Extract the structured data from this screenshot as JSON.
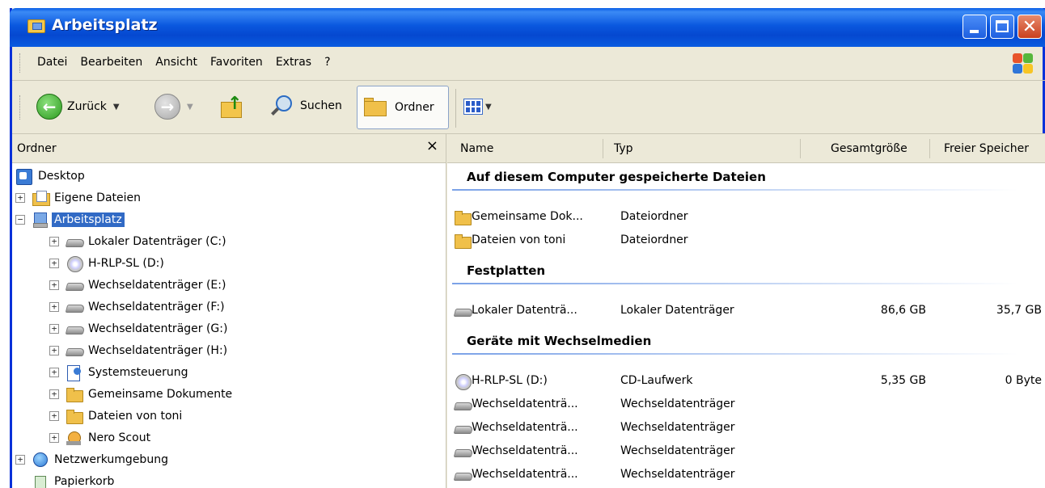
{
  "window": {
    "title": "Arbeitsplatz"
  },
  "menu": [
    "Datei",
    "Bearbeiten",
    "Ansicht",
    "Favoriten",
    "Extras",
    "?"
  ],
  "toolbar": {
    "back_label": "Zurück",
    "search_label": "Suchen",
    "folders_label": "Ordner"
  },
  "left_pane": {
    "title": "Ordner",
    "close_glyph": "×",
    "tree": [
      {
        "label": "Desktop",
        "icon": "desktop-icon",
        "level": 0,
        "toggle": ""
      },
      {
        "label": "Eigene Dateien",
        "icon": "my-documents-icon",
        "level": 1,
        "toggle": "+"
      },
      {
        "label": "Arbeitsplatz",
        "icon": "my-computer-icon",
        "level": 1,
        "toggle": "−",
        "selected": true
      },
      {
        "label": "Lokaler Datenträger (C:)",
        "icon": "hard-drive-icon",
        "level": 2,
        "toggle": "+"
      },
      {
        "label": "H-RLP-SL (D:)",
        "icon": "cd-drive-icon",
        "level": 2,
        "toggle": "+"
      },
      {
        "label": "Wechseldatenträger (E:)",
        "icon": "removable-drive-icon",
        "level": 2,
        "toggle": "+"
      },
      {
        "label": "Wechseldatenträger (F:)",
        "icon": "removable-drive-icon",
        "level": 2,
        "toggle": "+"
      },
      {
        "label": "Wechseldatenträger (G:)",
        "icon": "removable-drive-icon",
        "level": 2,
        "toggle": "+"
      },
      {
        "label": "Wechseldatenträger (H:)",
        "icon": "removable-drive-icon",
        "level": 2,
        "toggle": "+"
      },
      {
        "label": "Systemsteuerung",
        "icon": "control-panel-icon",
        "level": 2,
        "toggle": "+"
      },
      {
        "label": "Gemeinsame Dokumente",
        "icon": "folder-icon",
        "level": 2,
        "toggle": "+"
      },
      {
        "label": "Dateien von toni",
        "icon": "folder-icon",
        "level": 2,
        "toggle": "+"
      },
      {
        "label": "Nero Scout",
        "icon": "nero-scout-icon",
        "level": 2,
        "toggle": "+"
      },
      {
        "label": "Netzwerkumgebung",
        "icon": "network-icon",
        "level": 1,
        "toggle": "+"
      },
      {
        "label": "Papierkorb",
        "icon": "recycle-bin-icon",
        "level": 1,
        "toggle": ""
      }
    ]
  },
  "right_pane": {
    "columns": [
      "Name",
      "Typ",
      "Gesamtgröße",
      "Freier Speicher"
    ],
    "groups": [
      {
        "title": "Auf diesem Computer gespeicherte Dateien",
        "items": [
          {
            "name": "Gemeinsame Dok...",
            "type": "Dateiordner",
            "total": "",
            "free": "",
            "icon": "folder-icon"
          },
          {
            "name": "Dateien von toni",
            "type": "Dateiordner",
            "total": "",
            "free": "",
            "icon": "folder-icon"
          }
        ]
      },
      {
        "title": "Festplatten",
        "items": [
          {
            "name": "Lokaler Datenträ...",
            "type": "Lokaler Datenträger",
            "total": "86,6 GB",
            "free": "35,7 GB",
            "icon": "hard-drive-icon"
          }
        ]
      },
      {
        "title": "Geräte mit Wechselmedien",
        "items": [
          {
            "name": "H-RLP-SL (D:)",
            "type": "CD-Laufwerk",
            "total": "5,35 GB",
            "free": "0 Byte",
            "icon": "cd-drive-icon"
          },
          {
            "name": "Wechseldatenträ...",
            "type": "Wechseldatenträger",
            "total": "",
            "free": "",
            "icon": "removable-drive-icon"
          },
          {
            "name": "Wechseldatenträ...",
            "type": "Wechseldatenträger",
            "total": "",
            "free": "",
            "icon": "removable-drive-icon"
          },
          {
            "name": "Wechseldatenträ...",
            "type": "Wechseldatenträger",
            "total": "",
            "free": "",
            "icon": "removable-drive-icon"
          },
          {
            "name": "Wechseldatenträ...",
            "type": "Wechseldatenträger",
            "total": "",
            "free": "",
            "icon": "removable-drive-icon"
          }
        ]
      }
    ]
  }
}
